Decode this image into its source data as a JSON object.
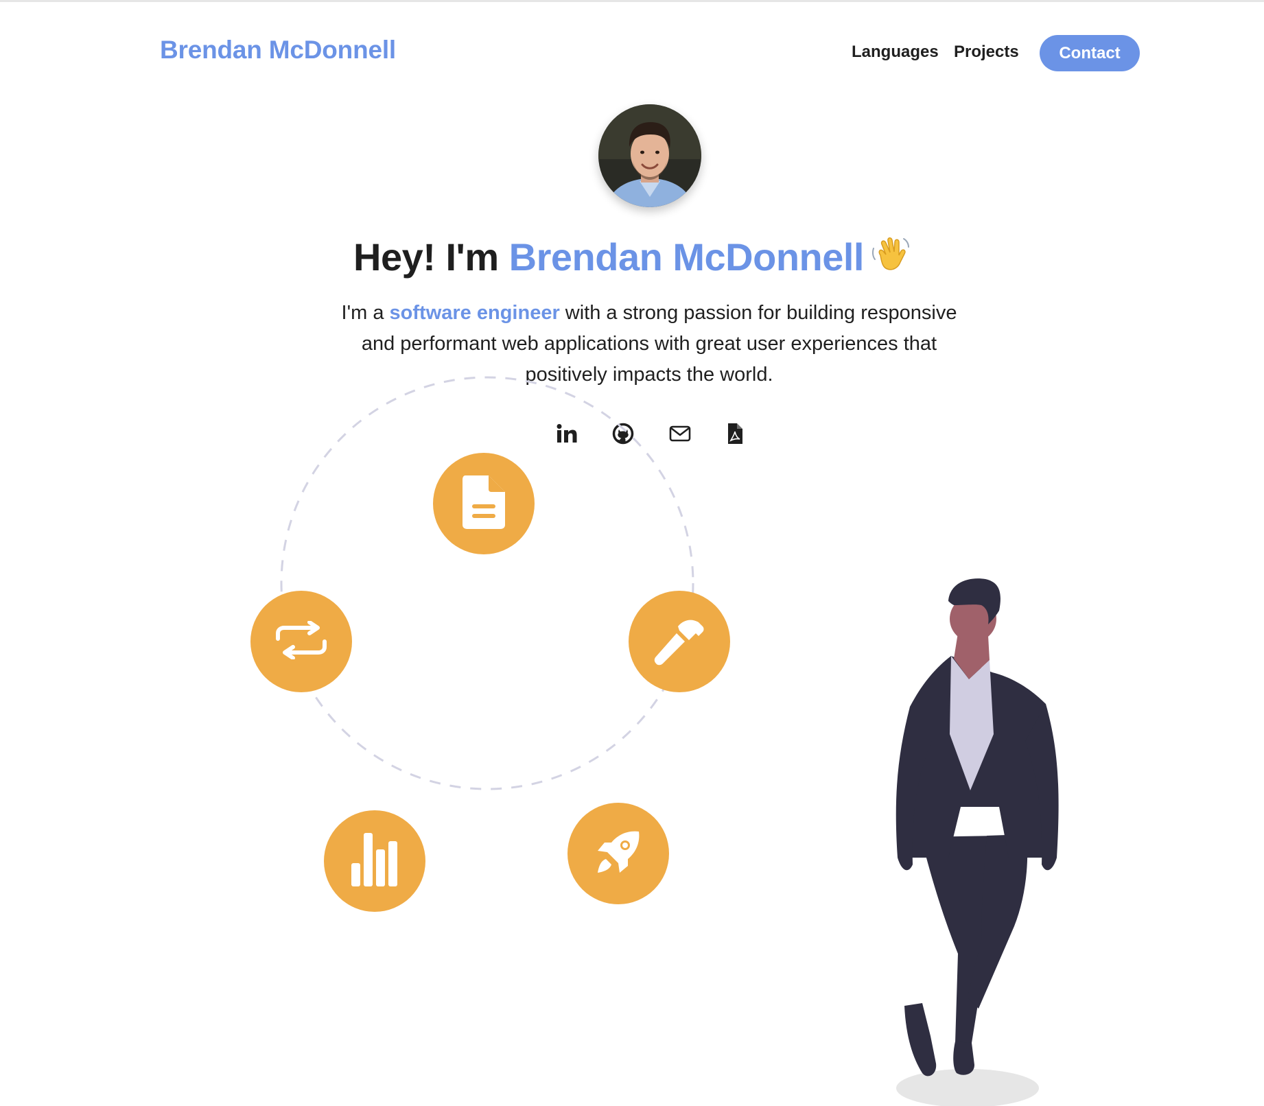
{
  "nav": {
    "brand": "Brendan McDonnell",
    "links": [
      "Languages",
      "Projects"
    ],
    "contact_label": "Contact"
  },
  "hero": {
    "greeting": "Hey! I'm ",
    "name": "Brendan McDonnell",
    "emoji": "👋",
    "bio_prefix": "I'm a ",
    "bio_highlight": "software engineer",
    "bio_suffix": " with a strong passion for building responsive and performant web applications with great user experiences that positively impacts the world."
  },
  "social_icons": [
    "linkedin-icon",
    "github-icon",
    "email-icon",
    "pdf-resume-icon"
  ],
  "cycle_icons": [
    "document-icon",
    "hammer-icon",
    "rocket-icon",
    "bar-chart-icon",
    "repeat-icon"
  ],
  "colors": {
    "accent": "#6b93e6",
    "step_orange": "#efab46",
    "text": "#1f1f1f",
    "suit": "#2f2e41"
  }
}
